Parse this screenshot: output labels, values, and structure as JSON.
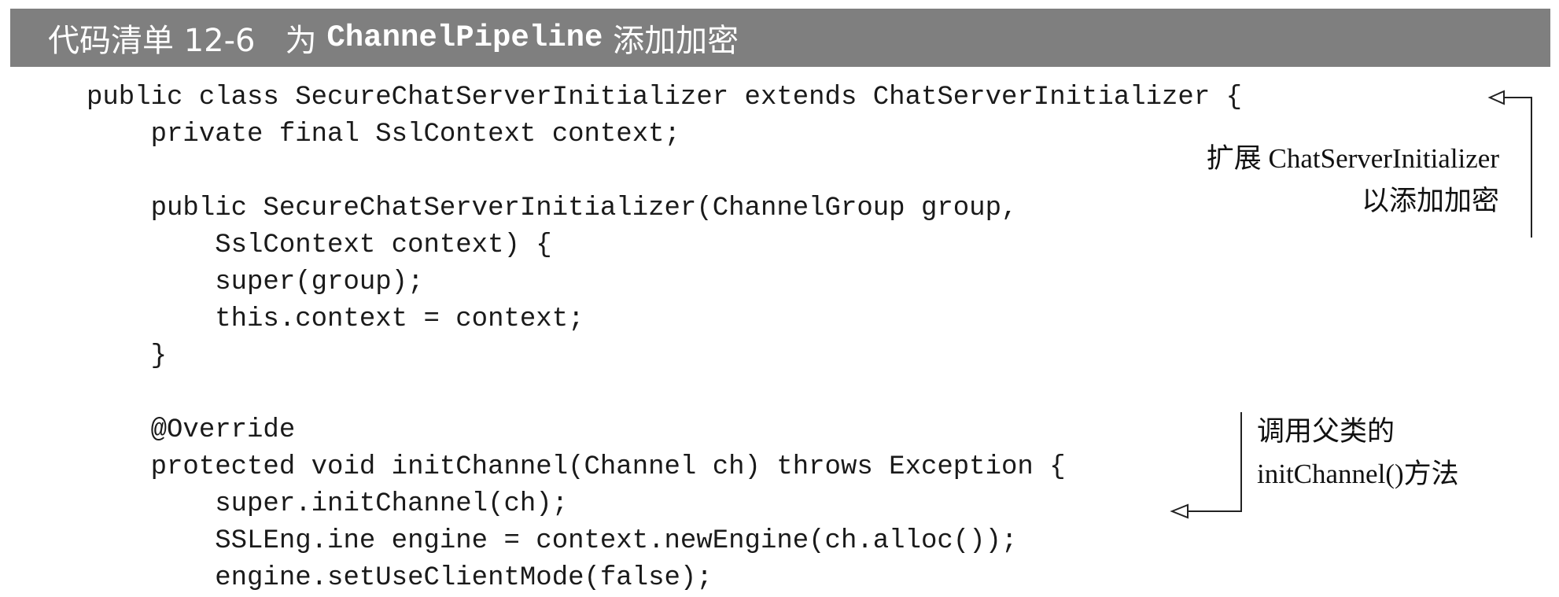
{
  "listing": {
    "caption_prefix": "代码清单 12-6",
    "caption_middle": "为 ",
    "caption_code": "ChannelPipeline",
    "caption_suffix": " 添加加密"
  },
  "code_lines": [
    "public class SecureChatServerInitializer extends ChatServerInitializer {",
    "    private final SslContext context;",
    "",
    "    public SecureChatServerInitializer(ChannelGroup group,",
    "        SslContext context) {",
    "        super(group);",
    "        this.context = context;",
    "    }",
    "",
    "    @Override",
    "    protected void initChannel(Channel ch) throws Exception {",
    "        super.initChannel(ch);",
    "        SSLEng.ine engine = context.newEngine(ch.alloc());",
    "        engine.setUseClientMode(false);"
  ],
  "annotations": {
    "extend_note": [
      "扩展 ChatServerInitializer",
      "以添加加密"
    ],
    "super_note": [
      "调用父类的",
      "initChannel()方法"
    ]
  },
  "colors": {
    "title_background": "#7f7f7f",
    "title_text": "#ffffff",
    "code_text": "#1a1a1a"
  }
}
